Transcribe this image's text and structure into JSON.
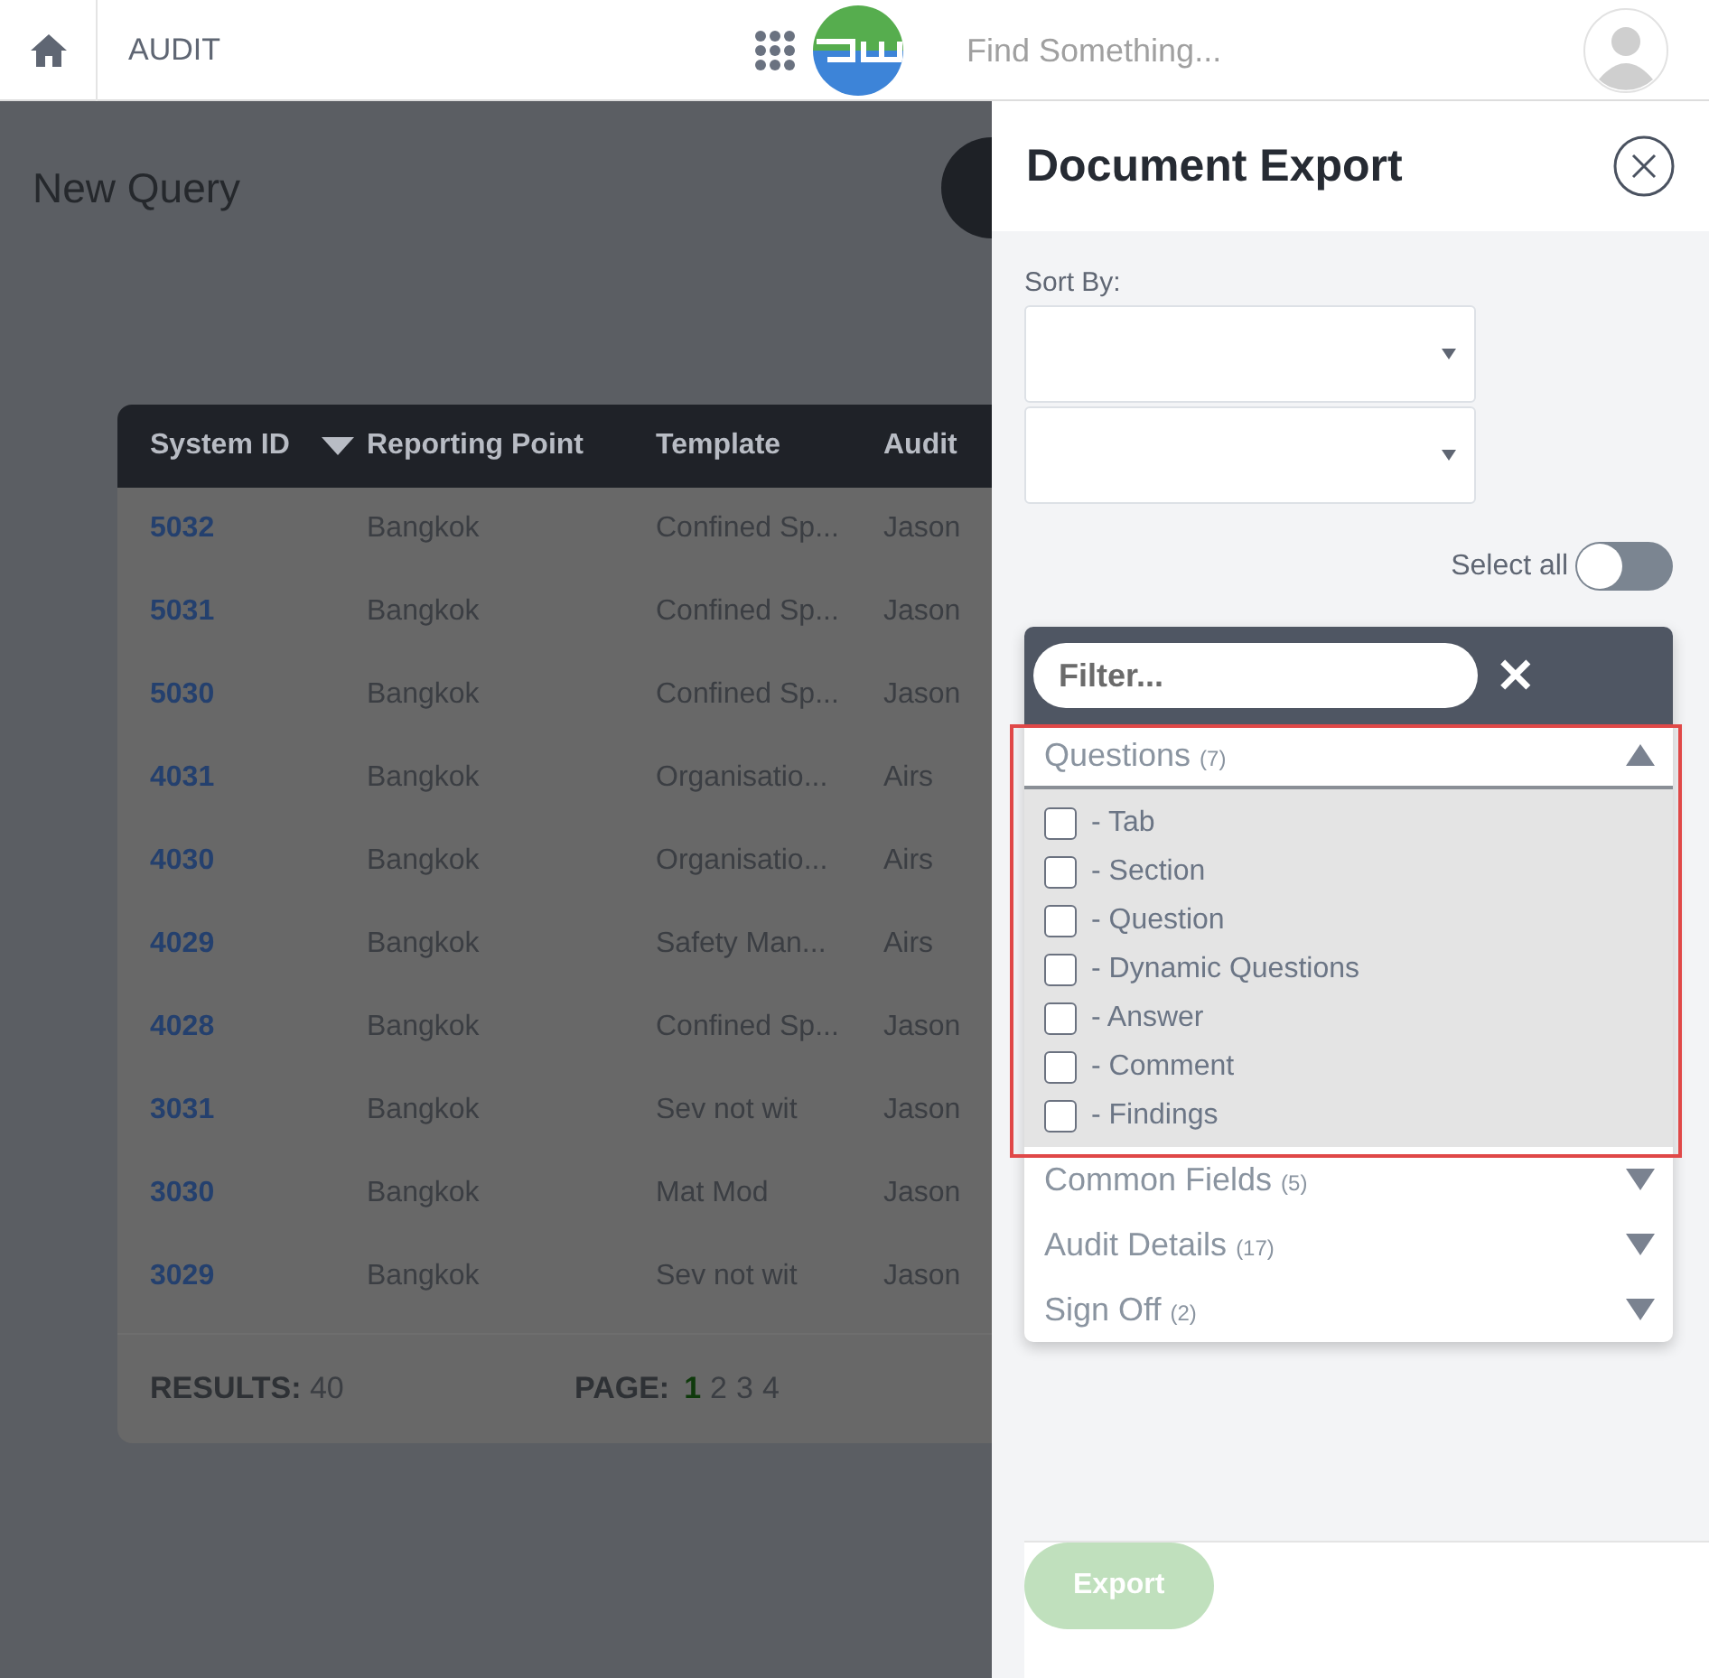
{
  "top_bar": {
    "module": "AUDIT",
    "search": {
      "placeholder": "Find Something..."
    }
  },
  "page": {
    "title": "New Query"
  },
  "table": {
    "columns": [
      {
        "label": "System ID",
        "sorted": true
      },
      {
        "label": "Reporting Point",
        "sorted": false
      },
      {
        "label": "Template",
        "sorted": false
      },
      {
        "label": "Audit",
        "sorted": false
      }
    ],
    "rows": [
      {
        "id": "5032",
        "point": "Bangkok",
        "template": "Confined Sp...",
        "column_4": "Jason"
      },
      {
        "id": "5031",
        "point": "Bangkok",
        "template": "Confined Sp...",
        "column_4": "Jason"
      },
      {
        "id": "5030",
        "point": "Bangkok",
        "template": "Confined Sp...",
        "column_4": "Jason"
      },
      {
        "id": "4031",
        "point": "Bangkok",
        "template": "Organisatio...",
        "column_4": "Airs"
      },
      {
        "id": "4030",
        "point": "Bangkok",
        "template": "Organisatio...",
        "column_4": "Airs"
      },
      {
        "id": "4029",
        "point": "Bangkok",
        "template": "Safety Man...",
        "column_4": "Airs"
      },
      {
        "id": "4028",
        "point": "Bangkok",
        "template": "Confined Sp...",
        "column_4": "Jason"
      },
      {
        "id": "3031",
        "point": "Bangkok",
        "template": "Sev not wit",
        "column_4": "Jason"
      },
      {
        "id": "3030",
        "point": "Bangkok",
        "template": "Mat Mod",
        "column_4": "Jason"
      },
      {
        "id": "3029",
        "point": "Bangkok",
        "template": "Sev not wit",
        "column_4": "Jason"
      }
    ],
    "results": {
      "label": "RESULTS:",
      "value": "40"
    },
    "pagination": {
      "label": "PAGE:",
      "pages": [
        {
          "label": "1",
          "selected": true
        },
        {
          "label": "2",
          "selected": false
        },
        {
          "label": "3",
          "selected": false
        },
        {
          "label": "4",
          "selected": false
        }
      ]
    }
  },
  "panel": {
    "title": "Document Export",
    "sort_by": {
      "label": "Sort By:"
    },
    "select_all": {
      "label": "Select all",
      "on": false
    },
    "filter": {
      "placeholder": "Filter...",
      "clear": "✕"
    },
    "sections": [
      {
        "label": "Questions",
        "count": "(7)",
        "expanded": true,
        "highlighted": true,
        "children": [
          {
            "label": "- Tab",
            "checked": false
          },
          {
            "label": "- Section",
            "checked": false
          },
          {
            "label": "- Question",
            "checked": false
          },
          {
            "label": "- Dynamic Questions",
            "checked": false
          },
          {
            "label": "- Answer",
            "checked": false
          },
          {
            "label": "- Comment",
            "checked": false
          },
          {
            "label": "- Findings",
            "checked": false
          }
        ]
      },
      {
        "label": "Common Fields",
        "count": "(5)",
        "expanded": false,
        "highlighted": false
      },
      {
        "label": "Audit Details",
        "count": "(17)",
        "expanded": false,
        "highlighted": false
      },
      {
        "label": "Sign Off",
        "count": "(2)",
        "expanded": false,
        "highlighted": false
      }
    ],
    "export": {
      "label": "Export",
      "disabled": true
    }
  }
}
